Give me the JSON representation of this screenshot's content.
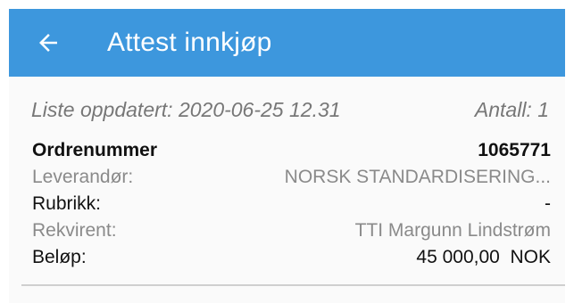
{
  "appbar": {
    "back_icon": "arrow-left-icon",
    "title": "Attest innkjøp",
    "background": "#3d97dd"
  },
  "list": {
    "updated_label": "Liste oppdatert: 2020-06-25 12.31",
    "count_label": "Antall: 1"
  },
  "order": {
    "order_number_label": "Ordrenummer",
    "order_number_value": "1065771",
    "supplier_label": "Leverandør:",
    "supplier_value": "NORSK STANDARDISERING...",
    "rubric_label": "Rubrikk:",
    "rubric_value": "-",
    "requester_label": "Rekvirent:",
    "requester_value": "TTI Margunn Lindstrøm",
    "amount_label": "Beløp:",
    "amount_value": "45 000,00  NOK"
  }
}
